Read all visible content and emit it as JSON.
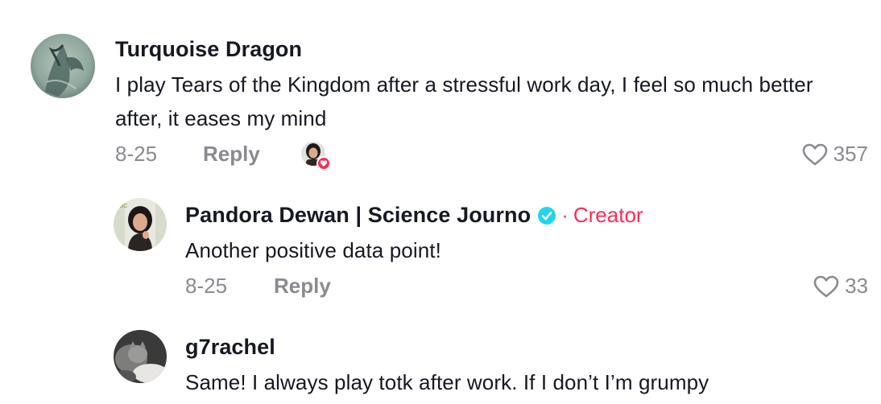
{
  "comments": [
    {
      "username": "Turquoise Dragon",
      "text": "I play Tears of the Kingdom after a stressful work day, I feel so much better after, it eases my mind",
      "date": "8-25",
      "reply_label": "Reply",
      "likes": "357",
      "creator_liked": true
    },
    {
      "username": "Pandora Dewan | Science Journo",
      "verified": true,
      "separator": "·",
      "creator_label": "Creator",
      "text": "Another positive data point!",
      "date": "8-25",
      "reply_label": "Reply",
      "likes": "33"
    },
    {
      "username": "g7rachel",
      "text": "Same! I always play totk after work. If I don’t I’m grumpy"
    }
  ],
  "colors": {
    "accent": "#fe2c55",
    "verified": "#20d5ec",
    "muted": "#8a8b91",
    "text": "#161823"
  },
  "icons": {
    "like": "heart-outline-icon",
    "verified": "verified-check-icon",
    "creator_heart": "creator-liked-heart-icon"
  }
}
